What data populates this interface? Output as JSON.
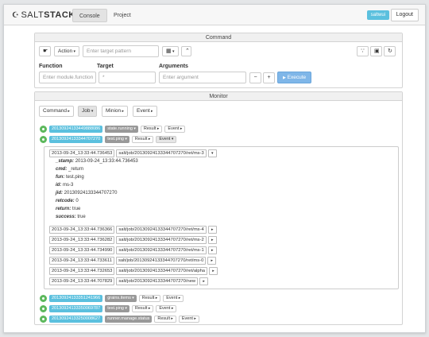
{
  "brand": {
    "salt": "SALT",
    "stack": "STACK"
  },
  "nav": {
    "console": "Console",
    "project": "Project"
  },
  "user": {
    "name": "saltwui",
    "logout": "Logout"
  },
  "command": {
    "title": "Command",
    "action_label": "Action",
    "target_pattern_placeholder": "Enter target pattern",
    "function_label": "Function",
    "function_placeholder": "Enter module.function",
    "target_label": "Target",
    "target_value": "*",
    "arguments_label": "Arguments",
    "argument_placeholder": "Enter argument",
    "minus": "−",
    "plus": "+",
    "execute": "Execute"
  },
  "monitor": {
    "title": "Monitor",
    "tabs": [
      "Command",
      "Job",
      "Minion",
      "Event"
    ],
    "result_label": "Result",
    "event_label": "Event",
    "jobs_top": [
      {
        "jid": "20130924133449888086",
        "fn": "state.running"
      },
      {
        "jid": "20130924133344707270",
        "fn": "test.ping"
      }
    ],
    "expanded": {
      "timestamp": "2013-09-24_13:33:44.736453",
      "tag": "salt/job/20130924133344707270/ret/ms-3",
      "fields": [
        {
          "k": "_stamp:",
          "v": "2013-09-24_13:33:44.736453"
        },
        {
          "k": "cmd:",
          "v": "_return"
        },
        {
          "k": "fun:",
          "v": "test.ping"
        },
        {
          "k": "id:",
          "v": "ms-3"
        },
        {
          "k": "jid:",
          "v": "20130924133344707270"
        },
        {
          "k": "retcode:",
          "v": "0"
        },
        {
          "k": "return:",
          "v": "true"
        },
        {
          "k": "success:",
          "v": "true"
        }
      ],
      "events": [
        {
          "ts": "2013-09-24_13:33:44.736366",
          "tag": "salt/job/20130924133344707270/ret/ms-4"
        },
        {
          "ts": "2013-09-24_13:33:44.736282",
          "tag": "salt/job/20130924133344707270/ret/ms-2"
        },
        {
          "ts": "2013-09-24_13:33:44.734990",
          "tag": "salt/job/20130924133344707270/ret/ms-1"
        },
        {
          "ts": "2013-09-24_13:33:44.733611",
          "tag": "salt/job/20130924133344707270/ret/ms-0"
        },
        {
          "ts": "2013-09-24_13:33:44.732653",
          "tag": "salt/job/20130924133344707270/ret/alpha"
        },
        {
          "ts": "2013-09-24_13:33:44.707829",
          "tag": "salt/job/20130924133344707270/new"
        }
      ]
    },
    "jobs_bottom": [
      {
        "jid": "20130924133351241966",
        "fn": "grains.items"
      },
      {
        "jid": "20130924133350069787",
        "fn": "test.ping"
      },
      {
        "jid": "20130924133250008627",
        "fn": "runner.manage.status"
      }
    ]
  },
  "colors": {
    "accent": "#5bc0de",
    "execute": "#7fb6e8",
    "ok": "#5cb85c"
  }
}
